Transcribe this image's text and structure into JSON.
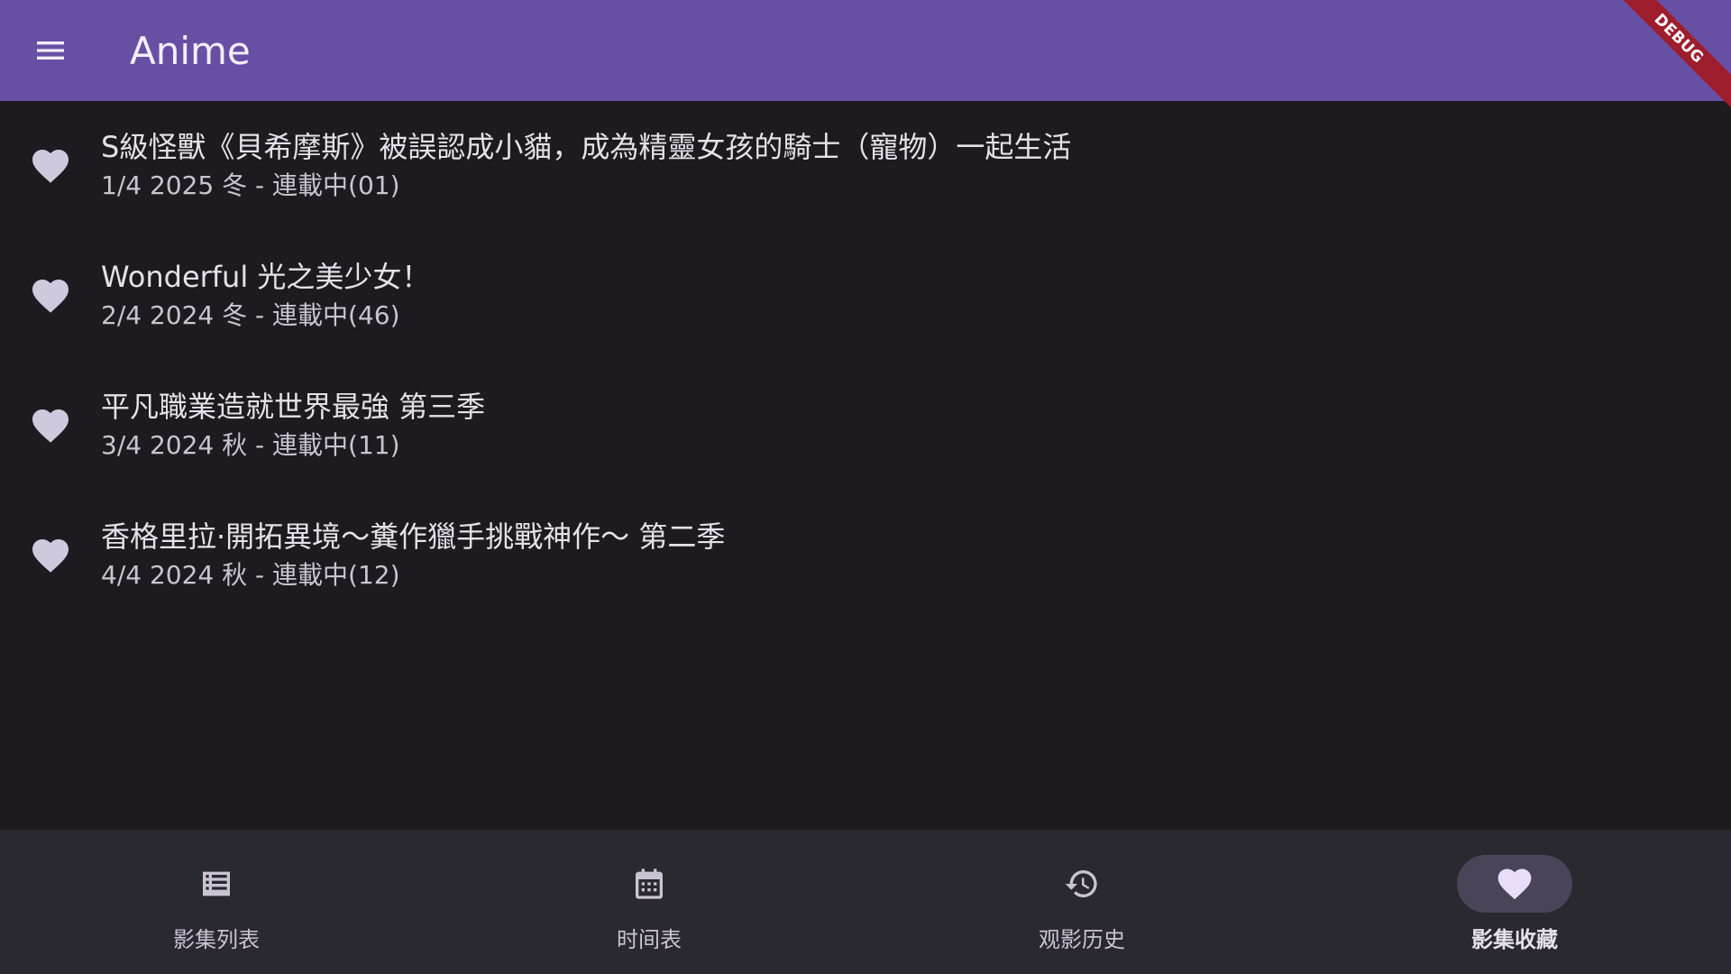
{
  "appbar": {
    "title": "Anime",
    "menu_icon": "menu-icon",
    "debug_label": "DEBUG"
  },
  "colors": {
    "appbar_bg": "#6750a4",
    "surface": "#1d1b20",
    "nav_bg": "#2b2930",
    "heart": "#d0c8dc",
    "active_indicator": "#4a4458",
    "debug_ribbon": "#9e1d2c"
  },
  "list": {
    "items": [
      {
        "icon": "heart-icon",
        "title": "S級怪獸《貝希摩斯》被誤認成小貓，成為精靈女孩的騎士（寵物）一起生活",
        "subtitle": "1/4 2025 冬 - 連載中(01)"
      },
      {
        "icon": "heart-icon",
        "title": "Wonderful 光之美少女！",
        "subtitle": "2/4 2024 冬 - 連載中(46)"
      },
      {
        "icon": "heart-icon",
        "title": "平凡職業造就世界最強 第三季",
        "subtitle": "3/4 2024 秋 - 連載中(11)"
      },
      {
        "icon": "heart-icon",
        "title": "香格里拉·開拓異境～糞作獵手挑戰神作～ 第二季",
        "subtitle": "4/4 2024 秋 - 連載中(12)"
      }
    ]
  },
  "bottom_nav": {
    "items": [
      {
        "icon": "list-icon",
        "label": "影集列表",
        "active": false
      },
      {
        "icon": "calendar-icon",
        "label": "时间表",
        "active": false
      },
      {
        "icon": "history-icon",
        "label": "观影历史",
        "active": false
      },
      {
        "icon": "heart-icon",
        "label": "影集收藏",
        "active": true
      }
    ]
  }
}
